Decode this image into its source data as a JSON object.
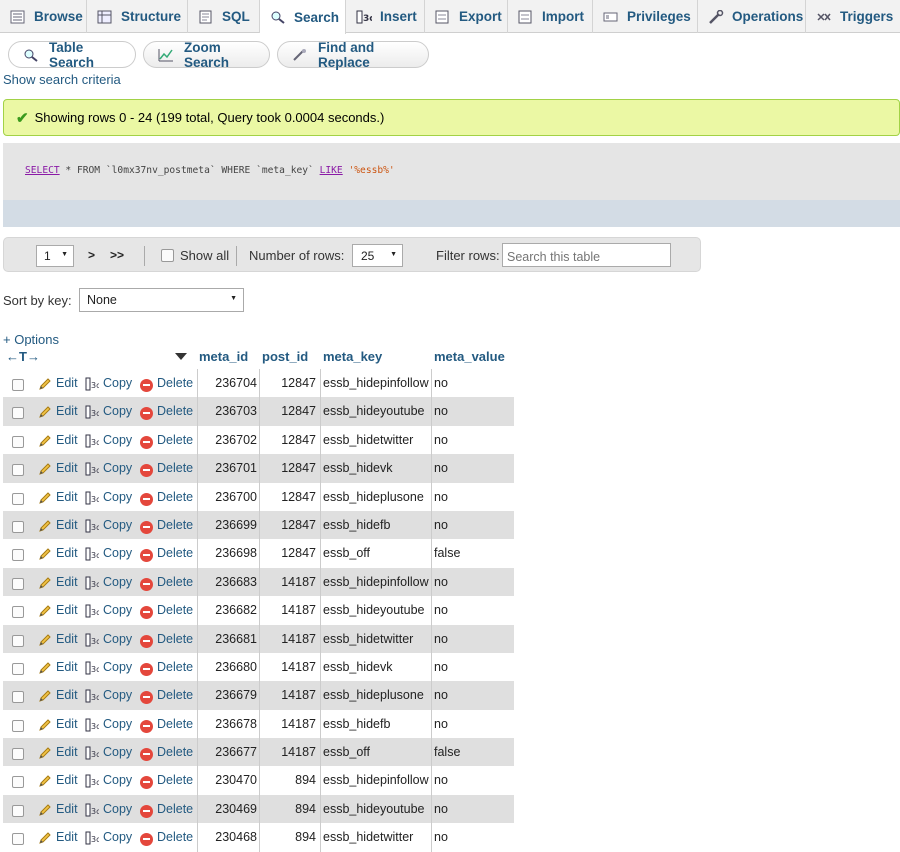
{
  "tabs": [
    {
      "label": "Browse",
      "icon": "browse-icon"
    },
    {
      "label": "Structure",
      "icon": "structure-icon"
    },
    {
      "label": "SQL",
      "icon": "sql-icon"
    },
    {
      "label": "Search",
      "icon": "search-icon",
      "active": true
    },
    {
      "label": "Insert",
      "icon": "insert-icon"
    },
    {
      "label": "Export",
      "icon": "export-icon"
    },
    {
      "label": "Import",
      "icon": "import-icon"
    },
    {
      "label": "Privileges",
      "icon": "privileges-icon"
    },
    {
      "label": "Operations",
      "icon": "wrench-icon"
    },
    {
      "label": "Triggers",
      "icon": "triggers-icon"
    }
  ],
  "subtabs": [
    {
      "label": "Table Search",
      "icon": "search-icon"
    },
    {
      "label": "Zoom Search",
      "icon": "chart-icon"
    },
    {
      "label": "Find and Replace",
      "icon": "replace-icon"
    }
  ],
  "criteria_link": "Show search criteria",
  "message": "Showing rows 0 - 24 (199 total, Query took 0.0004 seconds.)",
  "query": {
    "select": "SELECT",
    "star": " * ",
    "from": "FROM ",
    "table": "`l0mx37nv_postmeta`",
    "where": " WHERE ",
    "col": "`meta_key`",
    "like": "LIKE",
    "pattern": "'%essb%'"
  },
  "nav": {
    "page": "1",
    "next": ">",
    "last": ">>",
    "show_all": "Show all",
    "num_rows_label": "Number of rows:",
    "num_rows": "25",
    "filter_label": "Filter rows:",
    "filter_placeholder": "Search this table"
  },
  "sort": {
    "label": "Sort by key:",
    "value": "None"
  },
  "options_link": "+ Options",
  "table": {
    "arrows": "←T→",
    "columns": [
      "meta_id",
      "post_id",
      "meta_key",
      "meta_value"
    ],
    "actions": {
      "edit": "Edit",
      "copy": "Copy",
      "delete": "Delete"
    },
    "rows": [
      [
        "236704",
        "12847",
        "essb_hidepinfollow",
        "no"
      ],
      [
        "236703",
        "12847",
        "essb_hideyoutube",
        "no"
      ],
      [
        "236702",
        "12847",
        "essb_hidetwitter",
        "no"
      ],
      [
        "236701",
        "12847",
        "essb_hidevk",
        "no"
      ],
      [
        "236700",
        "12847",
        "essb_hideplusone",
        "no"
      ],
      [
        "236699",
        "12847",
        "essb_hidefb",
        "no"
      ],
      [
        "236698",
        "12847",
        "essb_off",
        "false"
      ],
      [
        "236683",
        "14187",
        "essb_hidepinfollow",
        "no"
      ],
      [
        "236682",
        "14187",
        "essb_hideyoutube",
        "no"
      ],
      [
        "236681",
        "14187",
        "essb_hidetwitter",
        "no"
      ],
      [
        "236680",
        "14187",
        "essb_hidevk",
        "no"
      ],
      [
        "236679",
        "14187",
        "essb_hideplusone",
        "no"
      ],
      [
        "236678",
        "14187",
        "essb_hidefb",
        "no"
      ],
      [
        "236677",
        "14187",
        "essb_off",
        "false"
      ],
      [
        "230470",
        "894",
        "essb_hidepinfollow",
        "no"
      ],
      [
        "230469",
        "894",
        "essb_hideyoutube",
        "no"
      ],
      [
        "230468",
        "894",
        "essb_hidetwitter",
        "no"
      ]
    ]
  }
}
